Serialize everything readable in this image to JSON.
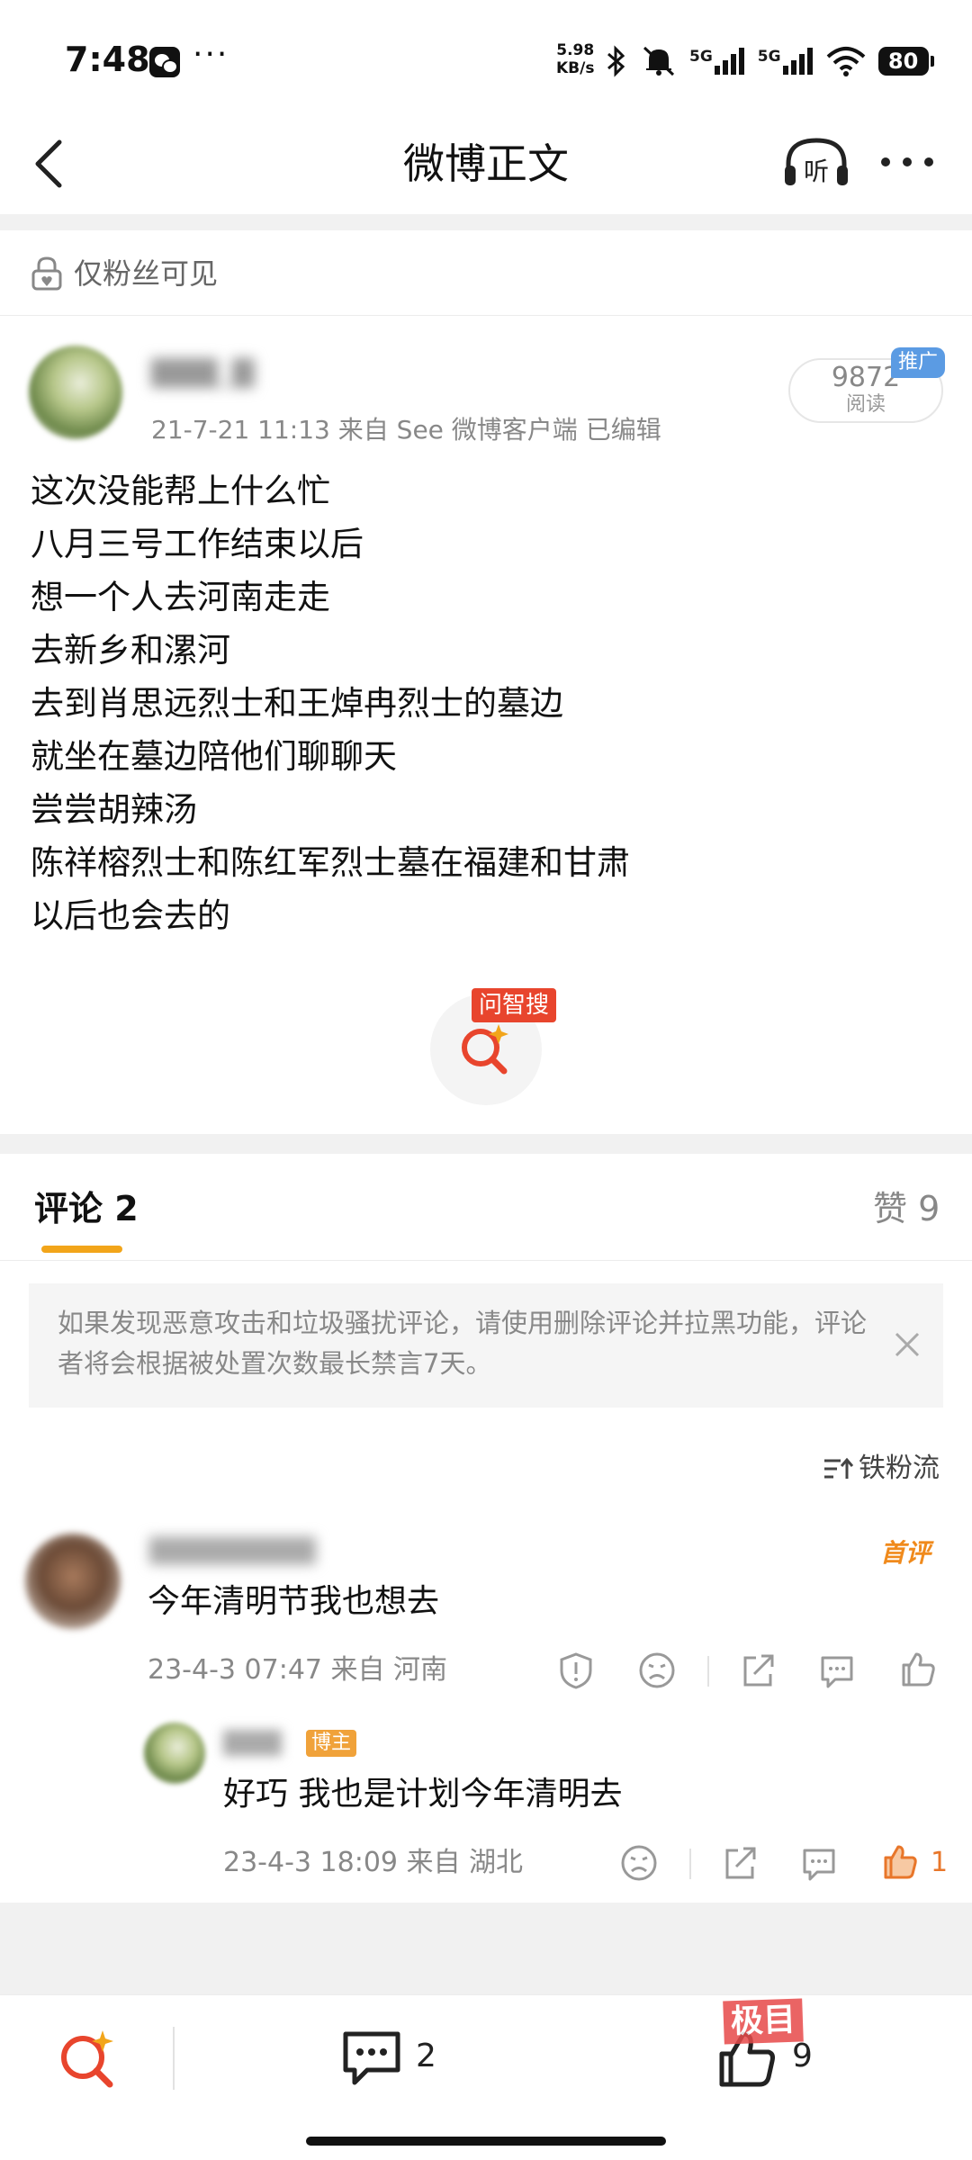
{
  "status_bar": {
    "time": "7:48",
    "more": "···",
    "net_speed_value": "5.98",
    "net_speed_unit": "KB/s",
    "signal_a": "5G",
    "signal_b": "5G",
    "battery": "80"
  },
  "nav": {
    "title": "微博正文",
    "listen_icon_label": "听"
  },
  "post": {
    "privacy": "仅粉丝可见",
    "meta": "21-7-21 11:13   来自 See 微博客户端   已编辑",
    "read_count": "9872",
    "read_label": "阅读",
    "promo_tag": "推广",
    "lines": [
      "这次没能帮上什么忙",
      "八月三号工作结束以后",
      "想一个人去河南走走",
      "去新乡和漯河",
      "去到肖思远烈士和王焯冉烈士的墓边",
      "就坐在墓边陪他们聊聊天",
      "尝尝胡辣汤",
      "陈祥榕烈士和陈红军烈士墓在福建和甘肃",
      "以后也会去的"
    ],
    "ai_search_tag": "问智搜"
  },
  "comments_header": {
    "comments_tab": "评论 2",
    "likes_tab": "赞 9"
  },
  "notice": {
    "text": "如果发现恶意攻击和垃圾骚扰评论，请使用删除评论并拉黑功能，评论者将会根据被处置次数最长禁言7天。"
  },
  "sort": {
    "label": "铁粉流"
  },
  "comment": {
    "first_badge": "首评",
    "text": "今年清明节我也想去",
    "meta": "23-4-3 07:47  来自 河南"
  },
  "reply": {
    "author_badge": "博主",
    "text": "好巧 我也是计划今年清明去",
    "meta": "23-4-3 18:09  来自 湖北",
    "like_count": "1"
  },
  "bottom_bar": {
    "comment_count": "2",
    "like_count": "9"
  },
  "watermark": "极目",
  "colors": {
    "accent_orange": "#f2a51a",
    "like_orange": "#e8762a",
    "tag_red": "#e8452d",
    "promo_blue": "#5b9be3"
  }
}
